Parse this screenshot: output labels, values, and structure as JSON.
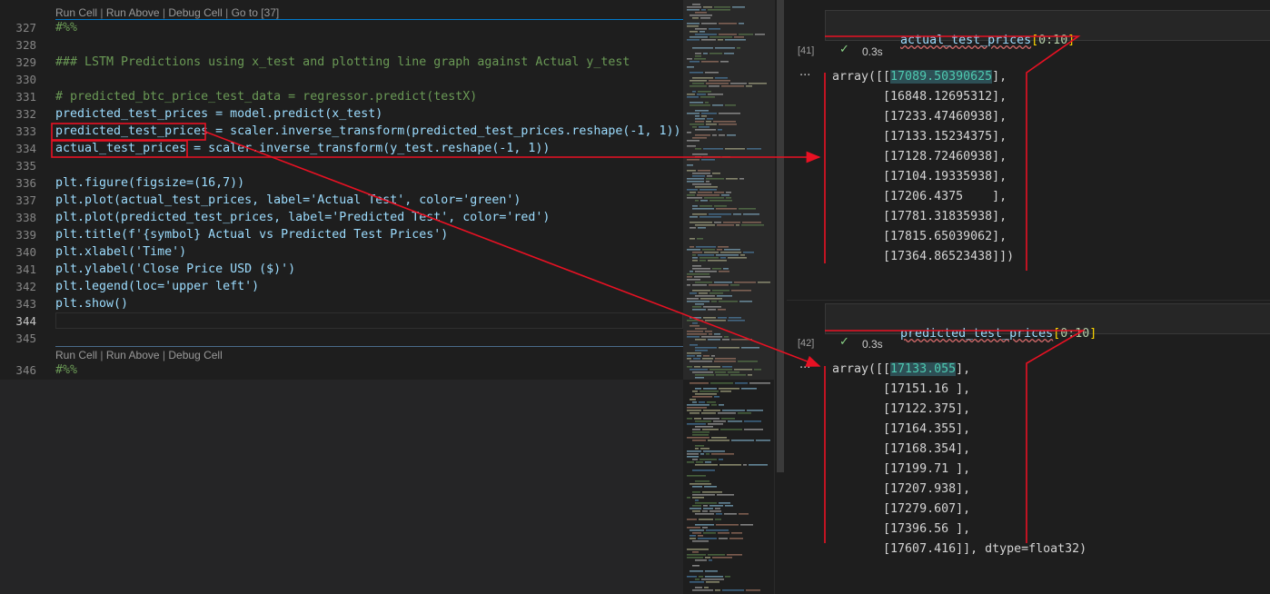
{
  "editor": {
    "codelens_top": [
      "Run Cell",
      "Run Above",
      "Debug Cell",
      "Go to [37]"
    ],
    "codelens_bottom": [
      "Run Cell",
      "Run Above",
      "Debug Cell"
    ],
    "codelens_sep": "|",
    "lines": [
      {
        "n": "327",
        "text": "#%%"
      },
      {
        "n": "328",
        "text": ""
      },
      {
        "n": "329",
        "text": "### LSTM Predictions using x_test and plotting line graph against Actual y_test"
      },
      {
        "n": "330",
        "text": ""
      },
      {
        "n": "331",
        "text": "# predicted_btc_price_test_data = regressor.predict(testX)"
      },
      {
        "n": "332",
        "text": "predicted_test_prices = model.predict(x_test)"
      },
      {
        "n": "333",
        "text": "predicted_test_prices = scaler.inverse_transform(predicted_test_prices.reshape(-1, 1))"
      },
      {
        "n": "334",
        "text": "actual_test_prices = scaler.inverse_transform(y_test.reshape(-1, 1))"
      },
      {
        "n": "335",
        "text": ""
      },
      {
        "n": "336",
        "text": "plt.figure(figsize=(16,7))"
      },
      {
        "n": "337",
        "text": "plt.plot(actual_test_prices, label='Actual Test', color='green')"
      },
      {
        "n": "338",
        "text": "plt.plot(predicted_test_prices, label='Predicted Test', color='red')"
      },
      {
        "n": "339",
        "text": "plt.title(f'{symbol} Actual vs Predicted Test Prices')"
      },
      {
        "n": "340",
        "text": "plt.xlabel('Time')"
      },
      {
        "n": "341",
        "text": "plt.ylabel('Close Price USD ($)')"
      },
      {
        "n": "342",
        "text": "plt.legend(loc='upper left')"
      },
      {
        "n": "343",
        "text": "plt.show()"
      },
      {
        "n": "344",
        "text": ""
      },
      {
        "n": "345",
        "text": ""
      },
      {
        "n": "346",
        "text": "#%%"
      }
    ]
  },
  "cells": [
    {
      "input_fn": "actual_test_prices",
      "input_open": "[",
      "input_slice": "0:10",
      "input_close": "]",
      "exec_count": "[41]",
      "duration": "0.3s",
      "output_lines": [
        "array([[17089.50390625],",
        "       [16848.12695312],",
        "       [17233.47460938],",
        "       [17133.15234375],",
        "       [17128.72460938],",
        "       [17104.19335938],",
        "       [17206.4375    ],",
        "       [17781.31835938],",
        "       [17815.65039062],",
        "       [17364.86523438]])"
      ],
      "first_value": "17089.50390625"
    },
    {
      "input_fn": "predicted_test_prices",
      "input_open": "[",
      "input_slice": "0:10",
      "input_close": "]",
      "exec_count": "[42]",
      "duration": "0.3s",
      "output_lines": [
        "array([[17133.055],",
        "       [17151.16 ],",
        "       [17122.375],",
        "       [17164.355],",
        "       [17168.354],",
        "       [17199.71 ],",
        "       [17207.938],",
        "       [17279.607],",
        "       [17396.56 ],",
        "       [17607.416]], dtype=float32)"
      ],
      "first_value": "17133.055"
    }
  ],
  "icons": {
    "check": "check-icon",
    "more": "ellipsis-icon"
  },
  "colors": {
    "accent_blue": "#007acc",
    "annotation_red": "#e81123",
    "success": "#89d185"
  }
}
